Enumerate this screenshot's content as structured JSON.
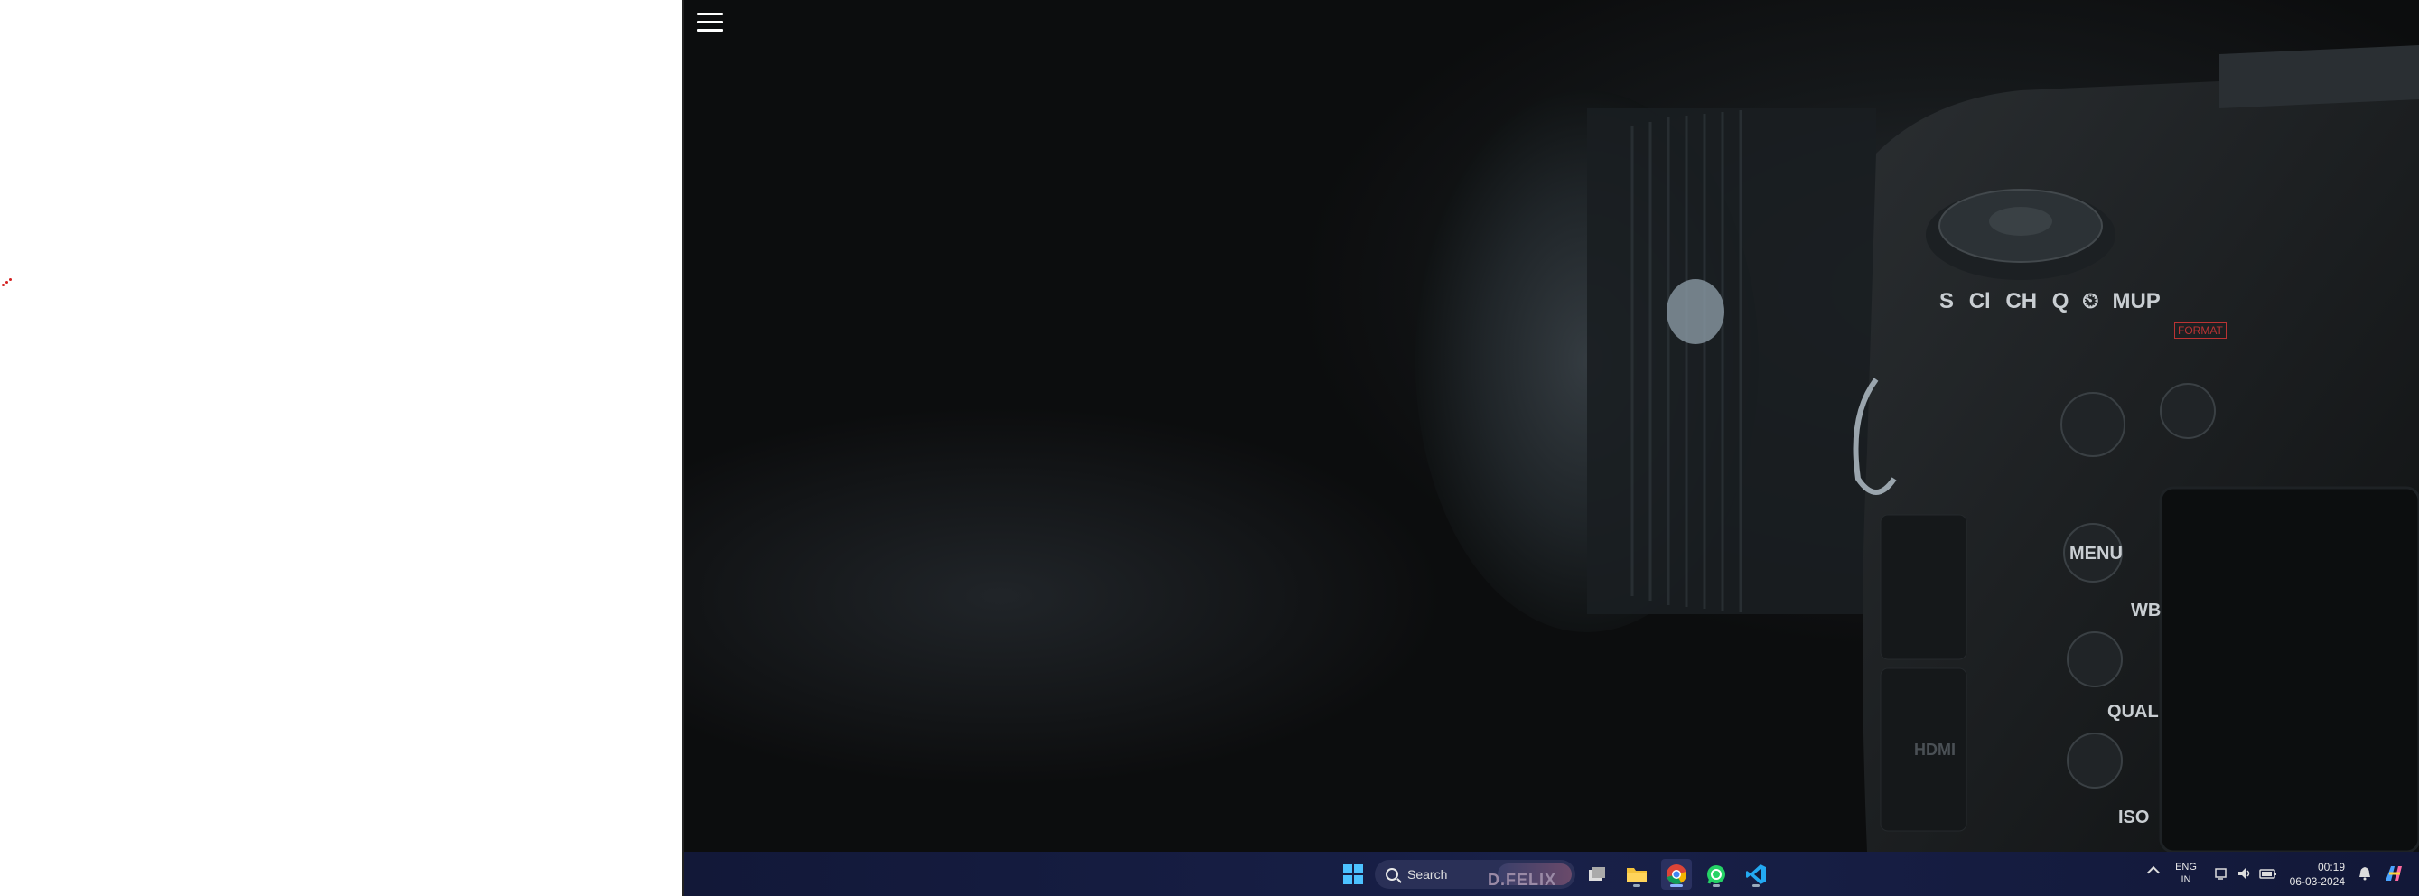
{
  "screen": {
    "left_panel": {
      "background": "#ffffff"
    },
    "desktop": {
      "wallpaper": "dark camera close-up (Nikon DSLR body with lens)",
      "camera_text": {
        "mode_dial_letters": [
          "S",
          "Cl",
          "CH",
          "Q",
          "⏲",
          "MUP"
        ],
        "format_label": "FORMAT",
        "button_menu": "MENU",
        "label_wb": "WB",
        "label_qual": "QUAL",
        "label_iso": "ISO",
        "label_hdmi": "HDMI"
      }
    }
  },
  "taskbar": {
    "search_label": "Search",
    "search_banner_text": "D.FELIX",
    "apps": [
      {
        "name": "start",
        "icon": "windows-start-icon"
      },
      {
        "name": "task-view",
        "icon": "task-view-icon"
      },
      {
        "name": "file-explorer",
        "icon": "folder-icon"
      },
      {
        "name": "chrome",
        "icon": "chrome-icon"
      },
      {
        "name": "whatsapp",
        "icon": "whatsapp-icon"
      },
      {
        "name": "vscode",
        "icon": "vscode-icon"
      }
    ],
    "tray": {
      "language_top": "ENG",
      "language_bottom": "IN",
      "time": "00:19",
      "date": "06-03-2024"
    }
  },
  "colors": {
    "taskbar_bg": "#151b3f",
    "accent_dots": "#d42020"
  }
}
